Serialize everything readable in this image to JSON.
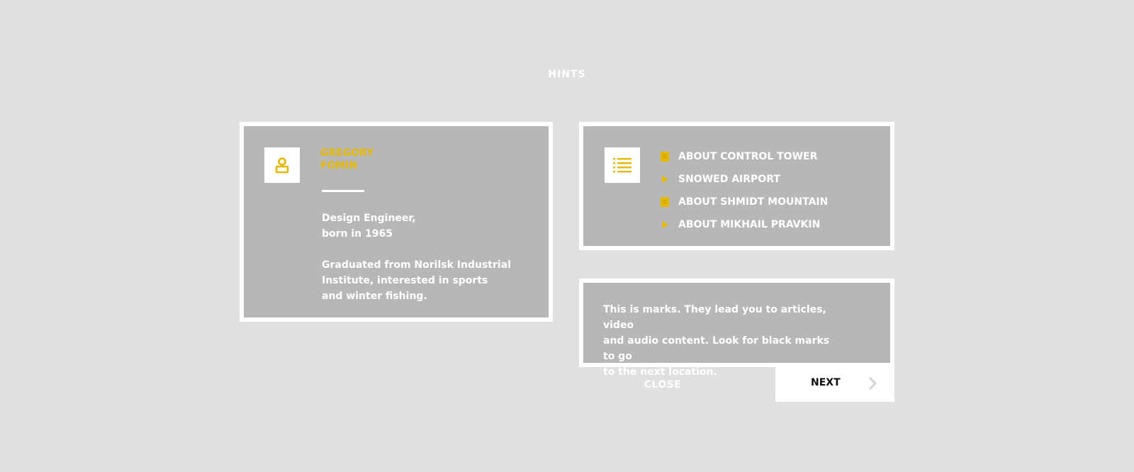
{
  "header": {
    "title": "HINTS"
  },
  "colors": {
    "accent": "#e6b800",
    "background": "#e0e0e0",
    "card": "#b7b7b7",
    "frame": "#ffffff"
  },
  "person_card": {
    "icon": "user-icon",
    "name_lines": [
      "GREGORY",
      "FOMIN"
    ],
    "description_lines": [
      "Design Engineer,",
      "born in 1965"
    ],
    "bio_lines": [
      "Graduated from Norilsk Industrial",
      "Institute, interested in sports",
      "and winter fishing."
    ]
  },
  "topics_card": {
    "icon": "list-icon",
    "items": [
      {
        "label": "ABOUT CONTROL TOWER",
        "icon": "article-icon"
      },
      {
        "label": "SNOWED AIRPORT",
        "icon": "play-icon"
      },
      {
        "label": "ABOUT SHMIDT MOUNTAIN",
        "icon": "article-icon"
      },
      {
        "label": "ABOUT MIKHAIL PRAVKIN",
        "icon": "play-icon"
      }
    ]
  },
  "hint_card": {
    "text_lines": [
      "This is marks. They lead you to articles, video",
      "and audio content. Look for black marks to go",
      "to the next location."
    ]
  },
  "actions": {
    "close_label": "CLOSE",
    "next_label": "NEXT",
    "next_icon": "chevron-right-icon"
  }
}
